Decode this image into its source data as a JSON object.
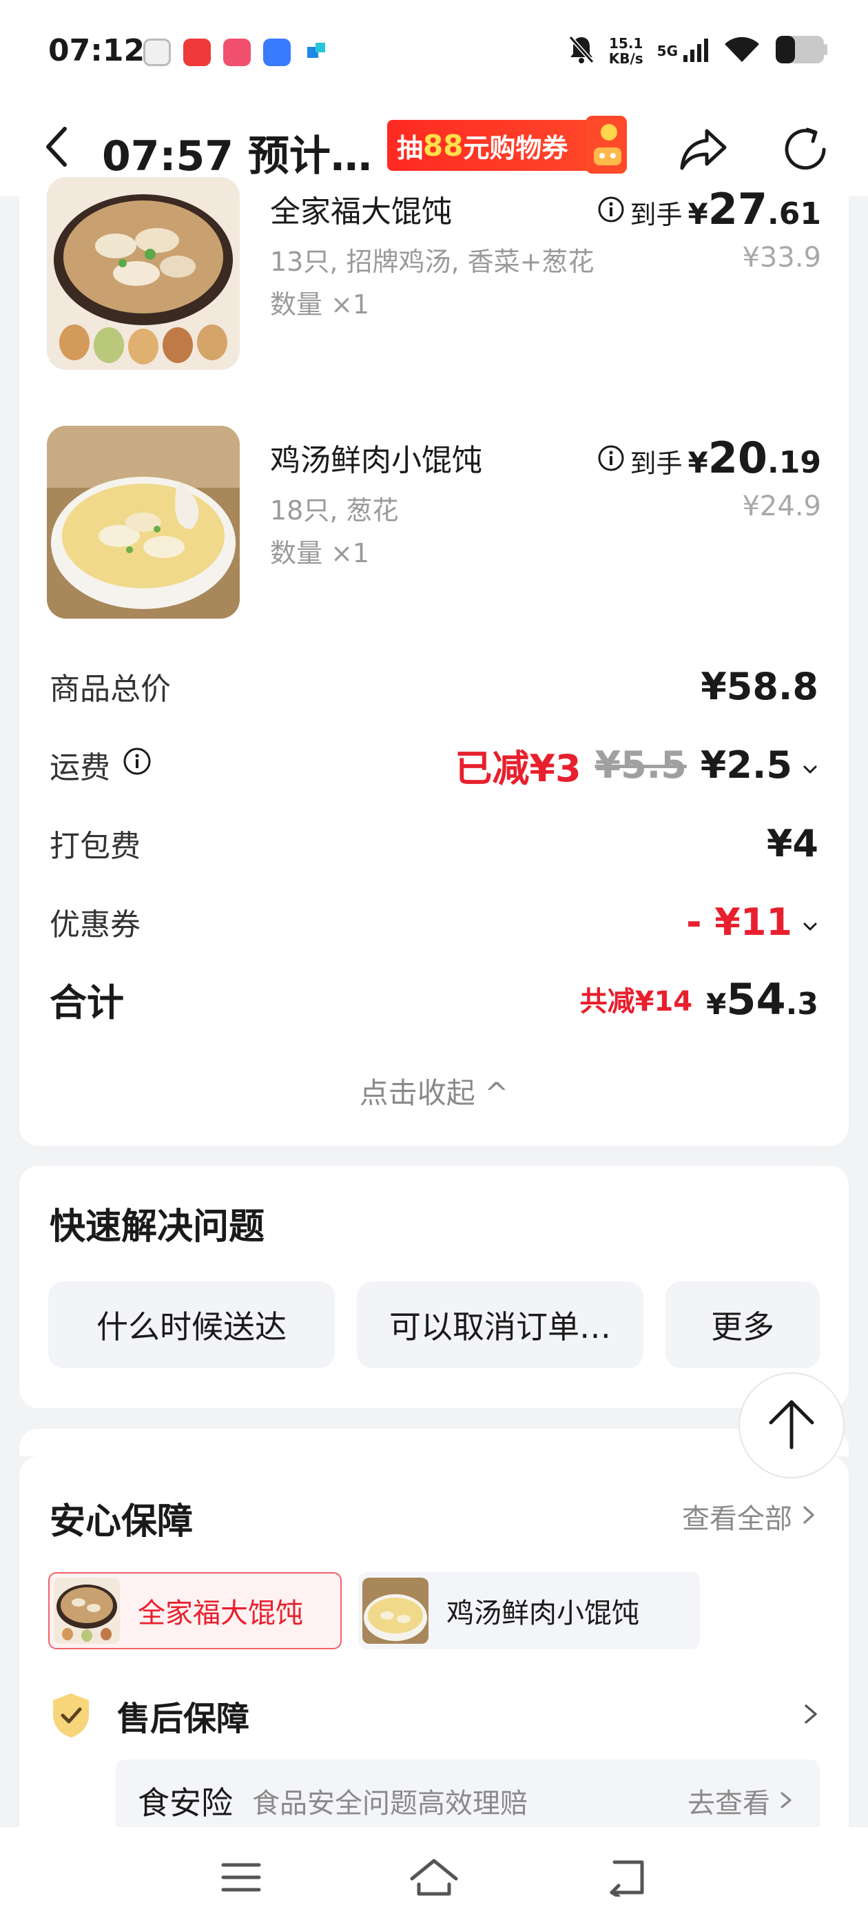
{
  "status_bar": {
    "time": "07:12",
    "net_speed_value": "15.1",
    "net_speed_unit": "KB/s",
    "network": "5G",
    "icons": [
      "silent-bell-icon",
      "signal-icon",
      "wifi-icon",
      "battery-icon"
    ]
  },
  "header": {
    "title": "07:57 预计…",
    "promo_prefix": "抽",
    "promo_amount": "88",
    "promo_suffix": "元购物券",
    "icons": [
      "back-icon",
      "share-icon",
      "refresh-icon"
    ]
  },
  "order": {
    "items": [
      {
        "name": "全家福大馄饨",
        "desc": "13只, 招牌鸡汤, 香菜+葱花",
        "qty": "数量 ×1",
        "arrive_label": "到手",
        "price_yen": "¥",
        "price_int": "27",
        "price_dec": ".61",
        "orig_price": "¥33.9"
      },
      {
        "name": "鸡汤鲜肉小馄饨",
        "desc": "18只, 葱花",
        "qty": "数量 ×1",
        "arrive_label": "到手",
        "price_yen": "¥",
        "price_int": "20",
        "price_dec": ".19",
        "orig_price": "¥24.9"
      }
    ],
    "subtotal_label": "商品总价",
    "subtotal_value": "¥58.8",
    "delivery_label": "运费",
    "delivery_discount": "已减¥3",
    "delivery_orig": "¥5.5",
    "delivery_value": "¥2.5",
    "packing_label": "打包费",
    "packing_value": "¥4",
    "coupon_label": "优惠券",
    "coupon_value": "- ¥11",
    "total_label": "合计",
    "total_saved": "共减¥14",
    "total_yen": "¥",
    "total_int": "54",
    "total_dec": ".3",
    "collapse_label": "点击收起 ^"
  },
  "quick_help": {
    "title": "快速解决问题",
    "chips": [
      "什么时候送达",
      "可以取消订单…",
      "更多"
    ]
  },
  "assurance": {
    "title": "安心保障",
    "see_all": "查看全部",
    "tabs": [
      "全家福大馄饨",
      "鸡汤鲜肉小馄饨"
    ],
    "after_sale": "售后保障",
    "insurance_name": "食安险",
    "insurance_desc": "食品安全问题高效理赔",
    "insurance_link": "去查看"
  },
  "colors": {
    "accent_red": "#e8202e",
    "page_bg": "#f2f3f5",
    "chip_bg": "#f3f4f7"
  }
}
